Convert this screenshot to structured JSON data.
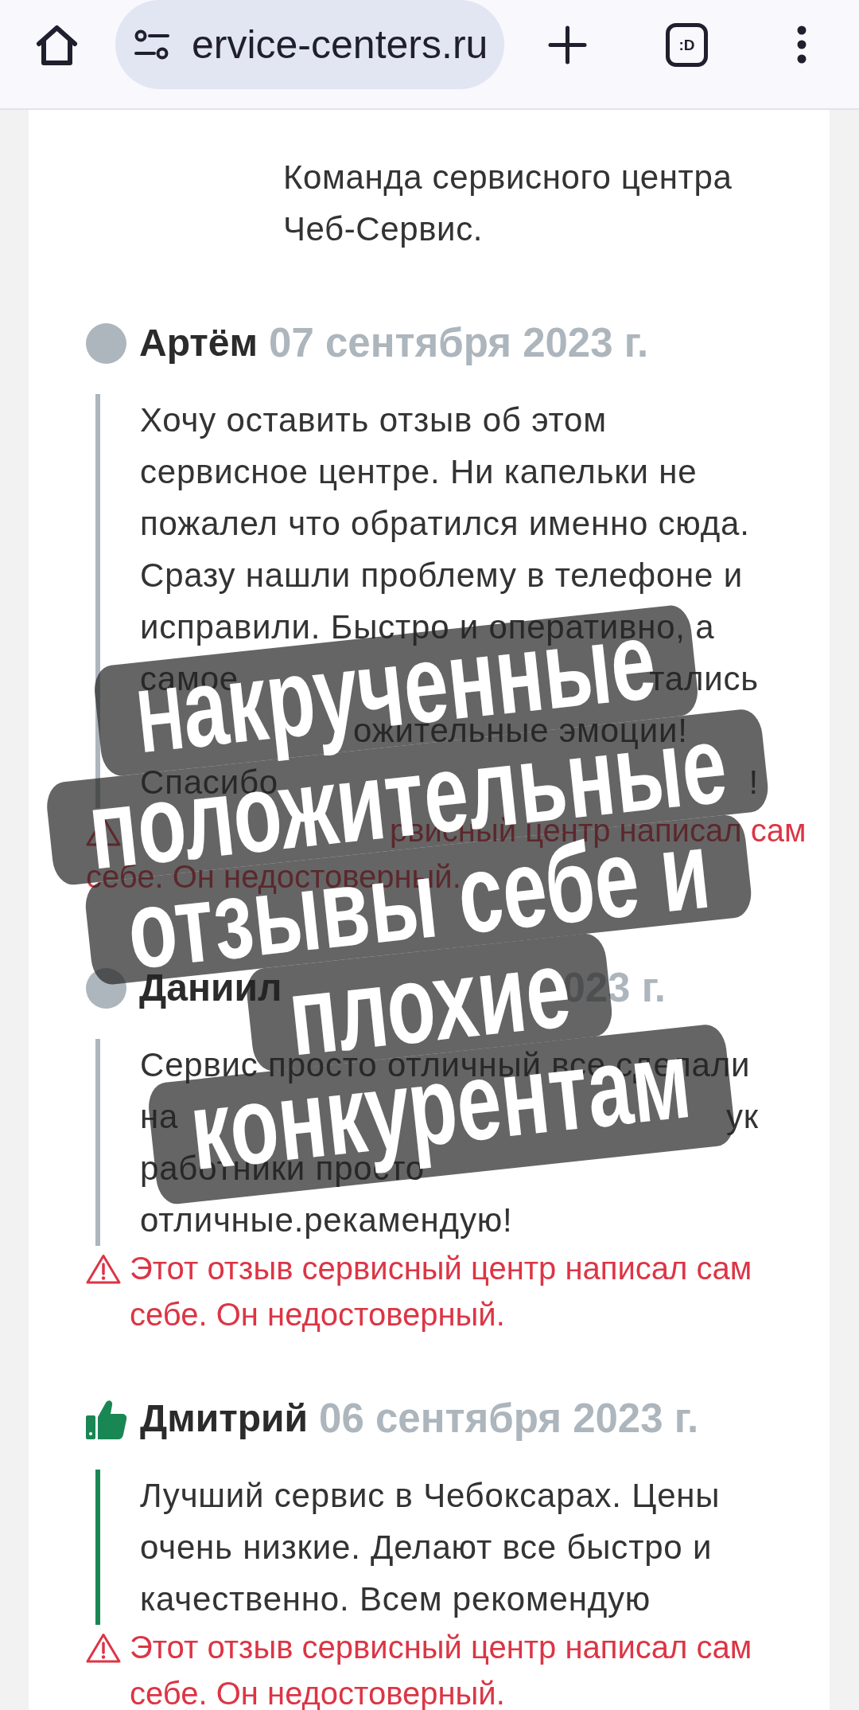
{
  "browser_bar": {
    "url": "ervice-centers.ru",
    "tab_switcher": ":D"
  },
  "reply": {
    "text": "Команда сервисного центра Чеб-Сервис."
  },
  "reviews": [
    {
      "kind": "neutral",
      "author": "Артём",
      "date": {
        "kind": "whole",
        "parts": [
          "07 сентября 2023 г."
        ]
      },
      "body": [
        {
          "kind": "whole",
          "parts": [
            "Хочу оставить отзыв об этом"
          ]
        },
        {
          "kind": "whole",
          "parts": [
            "сервисное центре. Ни капельки не"
          ]
        },
        {
          "kind": "whole",
          "parts": [
            "пожалел что обратился именно сюда."
          ]
        },
        {
          "kind": "whole",
          "parts": [
            "Сразу нашли проблему в телефоне и"
          ]
        },
        {
          "kind": "whole",
          "parts": [
            "исправили. Быстро и оперативно, а"
          ]
        },
        {
          "kind": "ends",
          "parts": [
            "самое",
            "тались"
          ]
        },
        {
          "kind": "tail",
          "parts": [
            "ожительные эмоции!"
          ]
        },
        {
          "kind": "ends",
          "parts": [
            "Спасибо",
            "!"
          ]
        }
      ],
      "warning": {
        "kind": "tail",
        "parts": [
          "рвисный центр написал сам",
          "себе. Он недостоверный."
        ]
      }
    },
    {
      "kind": "neutral",
      "author": "Даниил",
      "date": {
        "kind": "tail",
        "parts": [
          "023 г."
        ]
      },
      "body": [
        {
          "kind": "whole",
          "parts": [
            "Сервис просто отличный все сделали"
          ]
        },
        {
          "kind": "ends",
          "parts": [
            "на",
            "ук"
          ]
        },
        {
          "kind": "whole",
          "parts": [
            "работники просто"
          ]
        },
        {
          "kind": "whole",
          "parts": [
            "отличные.рекамендую!"
          ]
        }
      ],
      "warning": {
        "kind": "whole",
        "parts": [
          "Этот отзыв сервисный центр написал сам себе. Он недостоверный."
        ]
      }
    },
    {
      "kind": "positive",
      "author": "Дмитрий",
      "date": {
        "kind": "whole",
        "parts": [
          "06 сентября 2023 г."
        ]
      },
      "body": [
        {
          "kind": "whole",
          "parts": [
            "Лучший сервис в Чебоксарах. Цены"
          ]
        },
        {
          "kind": "whole",
          "parts": [
            "очень низкие. Делают все быстро и"
          ]
        },
        {
          "kind": "whole",
          "parts": [
            "качественно. Всем рекомендую"
          ]
        }
      ],
      "warning": {
        "kind": "whole",
        "parts": [
          "Этот отзыв сервисный центр написал сам себе. Он недостоверный."
        ]
      }
    }
  ],
  "caption": {
    "lines": [
      "Накрученные",
      "положительные",
      "отзывы себе и",
      "плохие",
      "конкурентам"
    ]
  }
}
